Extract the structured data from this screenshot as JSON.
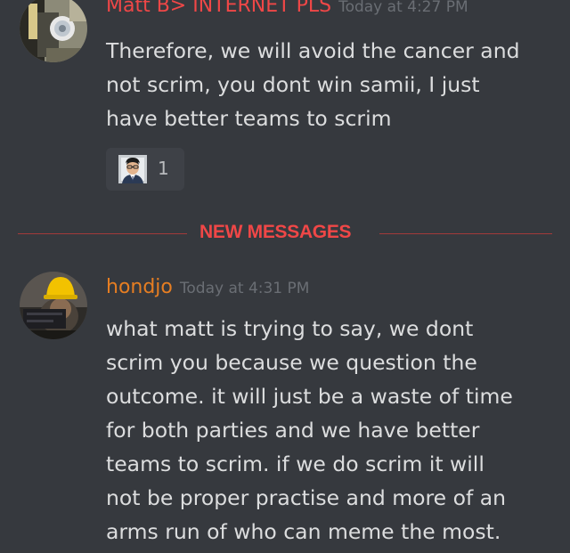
{
  "colors": {
    "background": "#36393e",
    "new_messages": "#f04747",
    "username": "#f04747",
    "timestamp": "#6a6e74",
    "text": "#dcddde"
  },
  "messages": [
    {
      "username": "Matt B> INTERNET PLS",
      "username_color": "#f04747",
      "timestamp": "Today at 4:27 PM",
      "lines": [
        "Therefore, we will avoid the cancer and",
        "not scrim, you dont win samii, I just",
        "have better teams to scrim"
      ],
      "reactions": [
        {
          "emoji": "man-face-emoji",
          "count": "1"
        }
      ]
    },
    {
      "username": "hondjo",
      "username_color": "#e67e22",
      "timestamp": "Today at 4:31 PM",
      "lines": [
        "what matt is trying to say, we dont",
        "scrim you because we question the",
        "outcome. it will just be a waste of time",
        "for both parties and we have better",
        "teams to scrim. if we do scrim it will",
        "not be proper practise and more of an",
        "arms run of who can meme the most."
      ]
    }
  ],
  "divider": {
    "label": "NEW MESSAGES"
  }
}
